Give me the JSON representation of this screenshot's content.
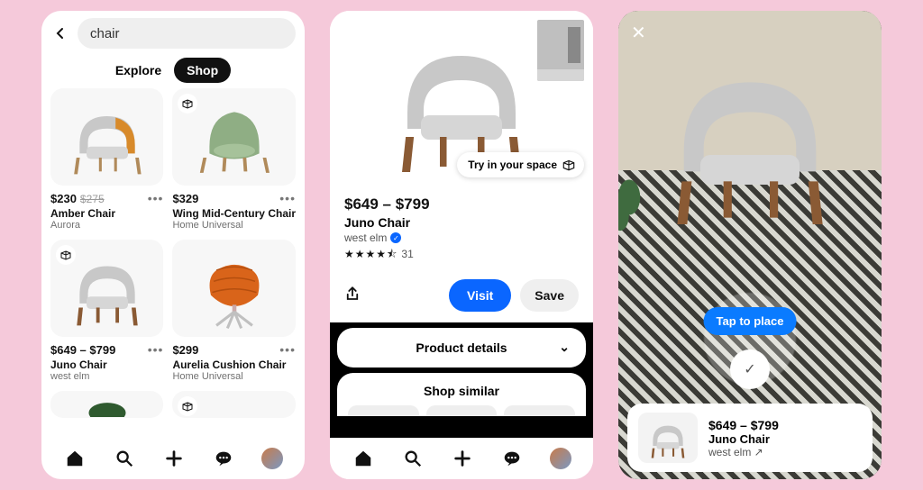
{
  "phone1": {
    "search_query": "chair",
    "tabs": {
      "explore": "Explore",
      "shop": "Shop"
    },
    "products": [
      {
        "price": "$230",
        "old_price": "$275",
        "name": "Amber Chair",
        "brand": "Aurora",
        "ar": false
      },
      {
        "price": "$329",
        "old_price": "",
        "name": "Wing Mid-Century Chair",
        "brand": "Home Universal",
        "ar": true
      },
      {
        "price": "$649 – $799",
        "old_price": "",
        "name": "Juno Chair",
        "brand": "west elm",
        "ar": true
      },
      {
        "price": "$299",
        "old_price": "",
        "name": "Aurelia Cushion Chair",
        "brand": "Home Universal",
        "ar": false
      }
    ]
  },
  "phone2": {
    "try_label": "Try in your space",
    "price": "$649 – $799",
    "name": "Juno Chair",
    "brand": "west elm",
    "rating_stars": "★★★★⯪",
    "rating_count": "31",
    "visit": "Visit",
    "save": "Save",
    "details": "Product details",
    "similar": "Shop similar"
  },
  "phone3": {
    "tap_label": "Tap to place",
    "card": {
      "price": "$649 – $799",
      "name": "Juno Chair",
      "brand": "west elm ↗"
    }
  }
}
